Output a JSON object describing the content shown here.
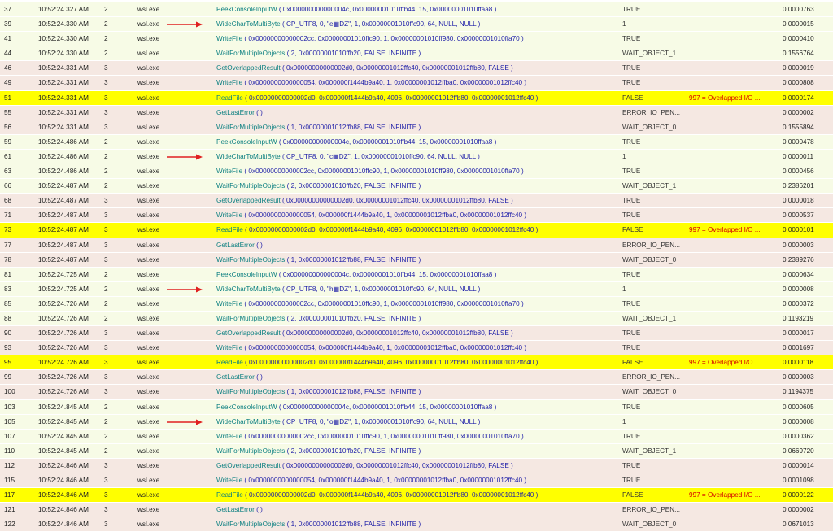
{
  "colors": {
    "thread2_bg": "#f7fbe6",
    "thread3_bg": "#f5e8e2",
    "highlight_bg": "#ffff00",
    "function_name": "#0b7f80",
    "arguments": "#1e1ea8",
    "error_text": "#d40000",
    "arrow": "#e02020"
  },
  "rows": [
    {
      "num": "37",
      "time": "10:52:24.327 AM",
      "thread": "2",
      "module": "wsl.exe",
      "arrow": false,
      "highlight": false,
      "fn": "PeekConsoleInputW",
      "args": " ( 0x000000000000004c, 0x00000001010ffb44, 15, 0x00000001010ffaa8 )",
      "result": "TRUE",
      "error": "",
      "duration": "0.0000763"
    },
    {
      "num": "39",
      "time": "10:52:24.330 AM",
      "thread": "2",
      "module": "wsl.exe",
      "arrow": true,
      "highlight": false,
      "fn": "WideCharToMultiByte",
      "args": " ( CP_UTF8, 0, \"e▦DZ\", 1, 0x00000001010ffc90, 64, NULL, NULL )",
      "result": "1",
      "error": "",
      "duration": "0.0000015"
    },
    {
      "num": "41",
      "time": "10:52:24.330 AM",
      "thread": "2",
      "module": "wsl.exe",
      "arrow": false,
      "highlight": false,
      "fn": "WriteFile",
      "args": " ( 0x00000000000002cc, 0x00000001010ffc90, 1, 0x00000001010ff980, 0x00000001010ffa70 )",
      "result": "TRUE",
      "error": "",
      "duration": "0.0000410"
    },
    {
      "num": "44",
      "time": "10:52:24.330 AM",
      "thread": "2",
      "module": "wsl.exe",
      "arrow": false,
      "highlight": false,
      "fn": "WaitForMultipleObjects",
      "args": " ( 2, 0x00000001010ffb20, FALSE, INFINITE )",
      "result": "WAIT_OBJECT_1",
      "error": "",
      "duration": "0.1556764"
    },
    {
      "num": "46",
      "time": "10:52:24.331 AM",
      "thread": "3",
      "module": "wsl.exe",
      "arrow": false,
      "highlight": false,
      "fn": "GetOverlappedResult",
      "args": " ( 0x00000000000002d0, 0x00000001012ffc40, 0x00000001012ffb80, FALSE )",
      "result": "TRUE",
      "error": "",
      "duration": "0.0000019"
    },
    {
      "num": "49",
      "time": "10:52:24.331 AM",
      "thread": "3",
      "module": "wsl.exe",
      "arrow": false,
      "highlight": false,
      "fn": "WriteFile",
      "args": " ( 0x0000000000000054, 0x000000f1444b9a40, 1, 0x00000001012ffba0, 0x00000001012ffc40 )",
      "result": "TRUE",
      "error": "",
      "duration": "0.0000808"
    },
    {
      "num": "51",
      "time": "10:52:24.331 AM",
      "thread": "3",
      "module": "wsl.exe",
      "arrow": false,
      "highlight": true,
      "fn": "ReadFile",
      "args": " ( 0x00000000000002d0, 0x000000f1444b9a40, 4096, 0x00000001012ffb80, 0x00000001012ffc40 )",
      "result": "FALSE",
      "error": "997 = Overlapped I/O ...",
      "duration": "0.0000174"
    },
    {
      "num": "55",
      "time": "10:52:24.331 AM",
      "thread": "3",
      "module": "wsl.exe",
      "arrow": false,
      "highlight": false,
      "fn": "GetLastError",
      "args": " ( )",
      "result": "ERROR_IO_PEN...",
      "error": "",
      "duration": "0.0000002"
    },
    {
      "num": "56",
      "time": "10:52:24.331 AM",
      "thread": "3",
      "module": "wsl.exe",
      "arrow": false,
      "highlight": false,
      "fn": "WaitForMultipleObjects",
      "args": " ( 1, 0x00000001012ffb88, FALSE, INFINITE )",
      "result": "WAIT_OBJECT_0",
      "error": "",
      "duration": "0.1555894"
    },
    {
      "num": "59",
      "time": "10:52:24.486 AM",
      "thread": "2",
      "module": "wsl.exe",
      "arrow": false,
      "highlight": false,
      "fn": "PeekConsoleInputW",
      "args": " ( 0x000000000000004c, 0x00000001010ffb44, 15, 0x00000001010ffaa8 )",
      "result": "TRUE",
      "error": "",
      "duration": "0.0000478"
    },
    {
      "num": "61",
      "time": "10:52:24.486 AM",
      "thread": "2",
      "module": "wsl.exe",
      "arrow": true,
      "highlight": false,
      "fn": "WideCharToMultiByte",
      "args": " ( CP_UTF8, 0, \"c▦DZ\", 1, 0x00000001010ffc90, 64, NULL, NULL )",
      "result": "1",
      "error": "",
      "duration": "0.0000011"
    },
    {
      "num": "63",
      "time": "10:52:24.486 AM",
      "thread": "2",
      "module": "wsl.exe",
      "arrow": false,
      "highlight": false,
      "fn": "WriteFile",
      "args": " ( 0x00000000000002cc, 0x00000001010ffc90, 1, 0x00000001010ff980, 0x00000001010ffa70 )",
      "result": "TRUE",
      "error": "",
      "duration": "0.0000456"
    },
    {
      "num": "66",
      "time": "10:52:24.487 AM",
      "thread": "2",
      "module": "wsl.exe",
      "arrow": false,
      "highlight": false,
      "fn": "WaitForMultipleObjects",
      "args": " ( 2, 0x00000001010ffb20, FALSE, INFINITE )",
      "result": "WAIT_OBJECT_1",
      "error": "",
      "duration": "0.2386201"
    },
    {
      "num": "68",
      "time": "10:52:24.487 AM",
      "thread": "3",
      "module": "wsl.exe",
      "arrow": false,
      "highlight": false,
      "fn": "GetOverlappedResult",
      "args": " ( 0x00000000000002d0, 0x00000001012ffc40, 0x00000001012ffb80, FALSE )",
      "result": "TRUE",
      "error": "",
      "duration": "0.0000018"
    },
    {
      "num": "71",
      "time": "10:52:24.487 AM",
      "thread": "3",
      "module": "wsl.exe",
      "arrow": false,
      "highlight": false,
      "fn": "WriteFile",
      "args": " ( 0x0000000000000054, 0x000000f1444b9a40, 1, 0x00000001012ffba0, 0x00000001012ffc40 )",
      "result": "TRUE",
      "error": "",
      "duration": "0.0000537"
    },
    {
      "num": "73",
      "time": "10:52:24.487 AM",
      "thread": "3",
      "module": "wsl.exe",
      "arrow": false,
      "highlight": true,
      "fn": "ReadFile",
      "args": " ( 0x00000000000002d0, 0x000000f1444b9a40, 4096, 0x00000001012ffb80, 0x00000001012ffc40 )",
      "result": "FALSE",
      "error": "997 = Overlapped I/O ...",
      "duration": "0.0000101"
    },
    {
      "num": "77",
      "time": "10:52:24.487 AM",
      "thread": "3",
      "module": "wsl.exe",
      "arrow": false,
      "highlight": false,
      "fn": "GetLastError",
      "args": " ( )",
      "result": "ERROR_IO_PEN...",
      "error": "",
      "duration": "0.0000003"
    },
    {
      "num": "78",
      "time": "10:52:24.487 AM",
      "thread": "3",
      "module": "wsl.exe",
      "arrow": false,
      "highlight": false,
      "fn": "WaitForMultipleObjects",
      "args": " ( 1, 0x00000001012ffb88, FALSE, INFINITE )",
      "result": "WAIT_OBJECT_0",
      "error": "",
      "duration": "0.2389276"
    },
    {
      "num": "81",
      "time": "10:52:24.725 AM",
      "thread": "2",
      "module": "wsl.exe",
      "arrow": false,
      "highlight": false,
      "fn": "PeekConsoleInputW",
      "args": " ( 0x000000000000004c, 0x00000001010ffb44, 15, 0x00000001010ffaa8 )",
      "result": "TRUE",
      "error": "",
      "duration": "0.0000634"
    },
    {
      "num": "83",
      "time": "10:52:24.725 AM",
      "thread": "2",
      "module": "wsl.exe",
      "arrow": true,
      "highlight": false,
      "fn": "WideCharToMultiByte",
      "args": " ( CP_UTF8, 0, \"h▦DZ\", 1, 0x00000001010ffc90, 64, NULL, NULL )",
      "result": "1",
      "error": "",
      "duration": "0.0000008"
    },
    {
      "num": "85",
      "time": "10:52:24.726 AM",
      "thread": "2",
      "module": "wsl.exe",
      "arrow": false,
      "highlight": false,
      "fn": "WriteFile",
      "args": " ( 0x00000000000002cc, 0x00000001010ffc90, 1, 0x00000001010ff980, 0x00000001010ffa70 )",
      "result": "TRUE",
      "error": "",
      "duration": "0.0000372"
    },
    {
      "num": "88",
      "time": "10:52:24.726 AM",
      "thread": "2",
      "module": "wsl.exe",
      "arrow": false,
      "highlight": false,
      "fn": "WaitForMultipleObjects",
      "args": " ( 2, 0x00000001010ffb20, FALSE, INFINITE )",
      "result": "WAIT_OBJECT_1",
      "error": "",
      "duration": "0.1193219"
    },
    {
      "num": "90",
      "time": "10:52:24.726 AM",
      "thread": "3",
      "module": "wsl.exe",
      "arrow": false,
      "highlight": false,
      "fn": "GetOverlappedResult",
      "args": " ( 0x00000000000002d0, 0x00000001012ffc40, 0x00000001012ffb80, FALSE )",
      "result": "TRUE",
      "error": "",
      "duration": "0.0000017"
    },
    {
      "num": "93",
      "time": "10:52:24.726 AM",
      "thread": "3",
      "module": "wsl.exe",
      "arrow": false,
      "highlight": false,
      "fn": "WriteFile",
      "args": " ( 0x0000000000000054, 0x000000f1444b9a40, 1, 0x00000001012ffba0, 0x00000001012ffc40 )",
      "result": "TRUE",
      "error": "",
      "duration": "0.0001697"
    },
    {
      "num": "95",
      "time": "10:52:24.726 AM",
      "thread": "3",
      "module": "wsl.exe",
      "arrow": false,
      "highlight": true,
      "fn": "ReadFile",
      "args": " ( 0x00000000000002d0, 0x000000f1444b9a40, 4096, 0x00000001012ffb80, 0x00000001012ffc40 )",
      "result": "FALSE",
      "error": "997 = Overlapped I/O ...",
      "duration": "0.0000118"
    },
    {
      "num": "99",
      "time": "10:52:24.726 AM",
      "thread": "3",
      "module": "wsl.exe",
      "arrow": false,
      "highlight": false,
      "fn": "GetLastError",
      "args": " ( )",
      "result": "ERROR_IO_PEN...",
      "error": "",
      "duration": "0.0000003"
    },
    {
      "num": "100",
      "time": "10:52:24.726 AM",
      "thread": "3",
      "module": "wsl.exe",
      "arrow": false,
      "highlight": false,
      "fn": "WaitForMultipleObjects",
      "args": " ( 1, 0x00000001012ffb88, FALSE, INFINITE )",
      "result": "WAIT_OBJECT_0",
      "error": "",
      "duration": "0.1194375"
    },
    {
      "num": "103",
      "time": "10:52:24.845 AM",
      "thread": "2",
      "module": "wsl.exe",
      "arrow": false,
      "highlight": false,
      "fn": "PeekConsoleInputW",
      "args": " ( 0x000000000000004c, 0x00000001010ffb44, 15, 0x00000001010ffaa8 )",
      "result": "TRUE",
      "error": "",
      "duration": "0.0000605"
    },
    {
      "num": "105",
      "time": "10:52:24.845 AM",
      "thread": "2",
      "module": "wsl.exe",
      "arrow": true,
      "highlight": false,
      "fn": "WideCharToMultiByte",
      "args": " ( CP_UTF8, 0, \"o▦DZ\", 1, 0x00000001010ffc90, 64, NULL, NULL )",
      "result": "1",
      "error": "",
      "duration": "0.0000008"
    },
    {
      "num": "107",
      "time": "10:52:24.845 AM",
      "thread": "2",
      "module": "wsl.exe",
      "arrow": false,
      "highlight": false,
      "fn": "WriteFile",
      "args": " ( 0x00000000000002cc, 0x00000001010ffc90, 1, 0x00000001010ff980, 0x00000001010ffa70 )",
      "result": "TRUE",
      "error": "",
      "duration": "0.0000362"
    },
    {
      "num": "110",
      "time": "10:52:24.845 AM",
      "thread": "2",
      "module": "wsl.exe",
      "arrow": false,
      "highlight": false,
      "fn": "WaitForMultipleObjects",
      "args": " ( 2, 0x00000001010ffb20, FALSE, INFINITE )",
      "result": "WAIT_OBJECT_1",
      "error": "",
      "duration": "0.0669720"
    },
    {
      "num": "112",
      "time": "10:52:24.846 AM",
      "thread": "3",
      "module": "wsl.exe",
      "arrow": false,
      "highlight": false,
      "fn": "GetOverlappedResult",
      "args": " ( 0x00000000000002d0, 0x00000001012ffc40, 0x00000001012ffb80, FALSE )",
      "result": "TRUE",
      "error": "",
      "duration": "0.0000014"
    },
    {
      "num": "115",
      "time": "10:52:24.846 AM",
      "thread": "3",
      "module": "wsl.exe",
      "arrow": false,
      "highlight": false,
      "fn": "WriteFile",
      "args": " ( 0x0000000000000054, 0x000000f1444b9a40, 1, 0x00000001012ffba0, 0x00000001012ffc40 )",
      "result": "TRUE",
      "error": "",
      "duration": "0.0001098"
    },
    {
      "num": "117",
      "time": "10:52:24.846 AM",
      "thread": "3",
      "module": "wsl.exe",
      "arrow": false,
      "highlight": true,
      "fn": "ReadFile",
      "args": " ( 0x00000000000002d0, 0x000000f1444b9a40, 4096, 0x00000001012ffb80, 0x00000001012ffc40 )",
      "result": "FALSE",
      "error": "997 = Overlapped I/O ...",
      "duration": "0.0000122"
    },
    {
      "num": "121",
      "time": "10:52:24.846 AM",
      "thread": "3",
      "module": "wsl.exe",
      "arrow": false,
      "highlight": false,
      "fn": "GetLastError",
      "args": " ( )",
      "result": "ERROR_IO_PEN...",
      "error": "",
      "duration": "0.0000002"
    },
    {
      "num": "122",
      "time": "10:52:24.846 AM",
      "thread": "3",
      "module": "wsl.exe",
      "arrow": false,
      "highlight": false,
      "fn": "WaitForMultipleObjects",
      "args": " ( 1, 0x00000001012ffb88, FALSE, INFINITE )",
      "result": "WAIT_OBJECT_0",
      "error": "",
      "duration": "0.0671013"
    }
  ]
}
